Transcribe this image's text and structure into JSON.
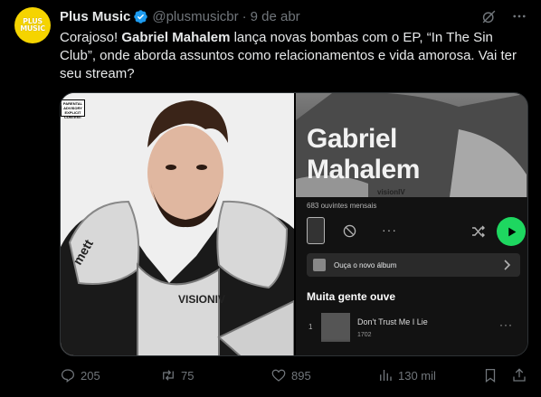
{
  "post": {
    "author": {
      "display_name": "Plus Music",
      "handle": "@plusmusicbr",
      "separator": "·",
      "date": "9 de abr",
      "avatar_text": "PLUS MUSIC",
      "brand_color": "#f5d400"
    },
    "text": {
      "part1": "Corajoso! ",
      "bold": "Gabriel Mahalem",
      "part2": " lança novas bombas com o EP, “In The Sin Club”, onde aborda assuntos como relacionamentos e vida amorosa. Vai ter seu stream?"
    },
    "media": {
      "left_image": {
        "badge": "PARENTAL ADVISORY EXPLICIT CONTENT",
        "shirt_text": "VISIONIV",
        "brand_text": "mett"
      },
      "spotify": {
        "artist_line1": "Gabriel",
        "artist_line2": "Mahalem",
        "hero_watermark": "visionIV",
        "monthly_listeners": "683 ouvintes mensais",
        "new_album_label": "Ouça o novo álbum",
        "section_title": "Muita gente ouve",
        "track_number": "1",
        "track_title": "Don't Trust Me I Lie",
        "track_plays": "1702",
        "more_glyph": "···",
        "accent": "#1ed760"
      }
    },
    "metrics": {
      "replies": "205",
      "reposts": "75",
      "likes": "895",
      "views": "130 mil"
    },
    "icons": [
      "verified-badge-icon",
      "grok-icon",
      "more-icon",
      "reply-icon",
      "repost-icon",
      "like-icon",
      "views-icon",
      "bookmark-icon",
      "share-icon"
    ]
  }
}
